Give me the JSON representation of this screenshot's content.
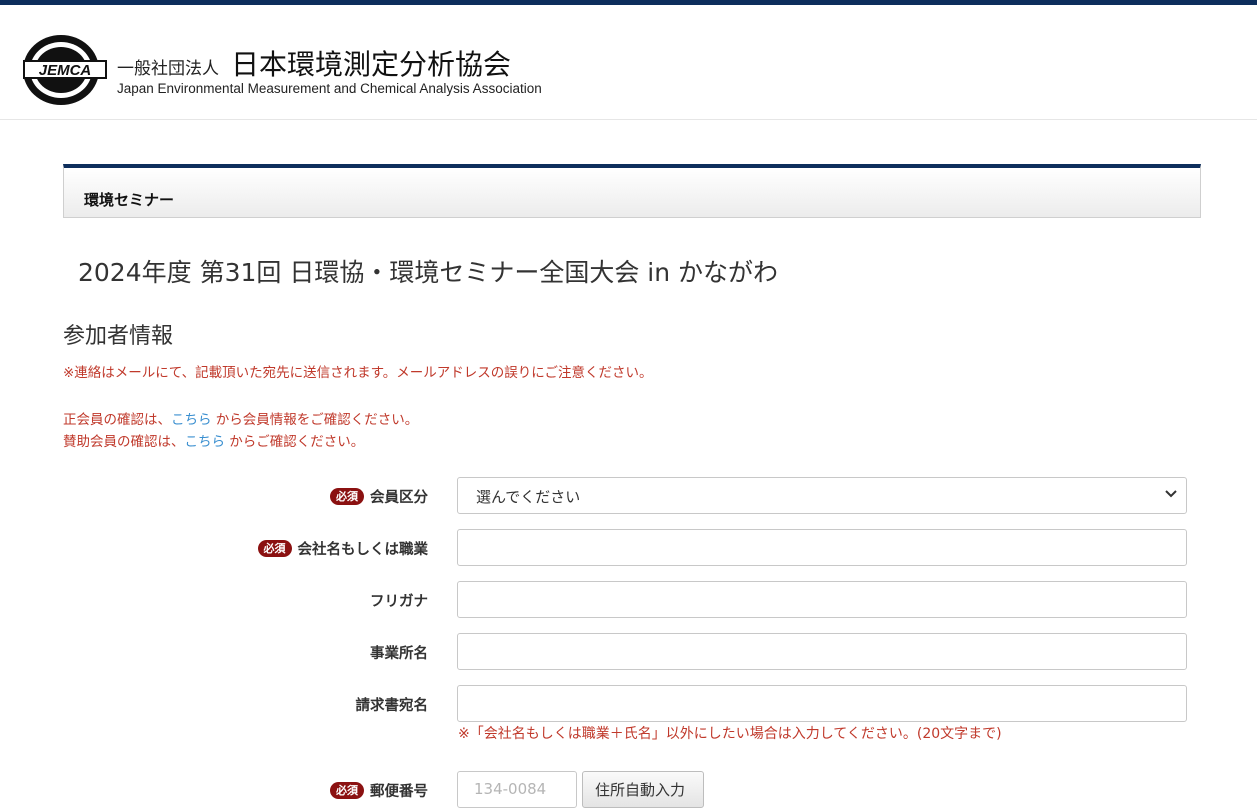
{
  "header": {
    "logo_text": "JEMCA",
    "org_prefix": "一般社団法人",
    "org_name": "日本環境測定分析協会",
    "org_english": "Japan Environmental Measurement and Chemical Analysis Association"
  },
  "section": {
    "title": "環境セミナー"
  },
  "event": {
    "title": "2024年度 第31回 日環協・環境セミナー全国大会 in かながわ"
  },
  "participant": {
    "heading": "参加者情報",
    "notice_mail": "※連絡はメールにて、記載頂いた宛先に送信されます。メールアドレスの誤りにご注意ください。",
    "notice_regular_pre": "正会員の確認は、",
    "notice_regular_link": "こちら",
    "notice_regular_post": " から会員情報をご確認ください。",
    "notice_support_pre": "賛助会員の確認は、",
    "notice_support_link": "こちら",
    "notice_support_post": " からご確認ください。"
  },
  "form": {
    "required_badge": "必須",
    "member_type": {
      "label": "会員区分",
      "value": "選んでください",
      "required": true
    },
    "company": {
      "label": "会社名もしくは職業",
      "value": "",
      "required": true
    },
    "furigana": {
      "label": "フリガナ",
      "value": "",
      "required": false
    },
    "office": {
      "label": "事業所名",
      "value": "",
      "required": false
    },
    "invoice": {
      "label": "請求書宛名",
      "value": "",
      "required": false,
      "note": "※「会社名もしくは職業＋氏名」以外にしたい場合は入力してください。(20文字まで)"
    },
    "postal": {
      "label": "郵便番号",
      "placeholder": "134-0084",
      "required": true,
      "auto_button": "住所自動入力"
    }
  },
  "colors": {
    "accent_navy": "#0d2e5c",
    "notice_red": "#c0392b",
    "link_blue": "#3a8fd0",
    "required_badge": "#8b1111"
  }
}
